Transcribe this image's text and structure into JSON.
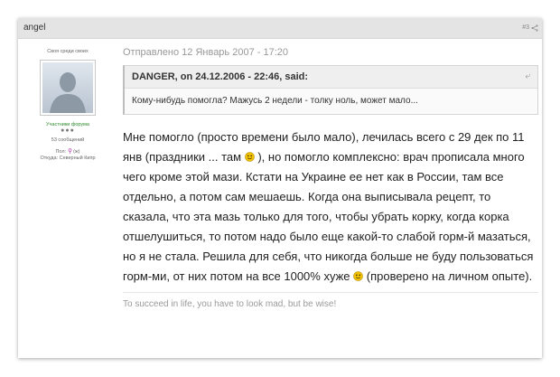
{
  "post": {
    "author": "angel",
    "number": "#3",
    "sidebar": {
      "member_title": "Своя среди своих",
      "group": "Участники форума",
      "pips": "●●●",
      "post_count": "53 сообщений",
      "gender_label": "Пол:",
      "gender_value": "(ж)",
      "location": "Откуда: Северный Кипр"
    },
    "posted_date": "Отправлено 12 Январь 2007 - 17:20",
    "quote": {
      "header": "DANGER, on 24.12.2006 - 22:46, said:",
      "text": "Кому-нибудь помогла? Мажусь 2 недели - толку ноль, может мало..."
    },
    "body": {
      "part1": "Мне помогло (просто времени было мало), лечилась всего с 29 дек по 11 янв (праздники ... там ",
      "part2": " ), но помогло комплексно: врач прописала много чего кроме этой мази. Кстати на Украине ее нет как в России, там все отдельно, а потом сам мешаешь. Когда она выписывала рецепт, то сказала, что эта мазь только для того, чтобы убрать корку, когда корка отшелушиться, то потом надо было еще какой-то слабой горм-й мазаться, но я не стала. Решила для себя, что никогда больше не буду пользоваться горм-ми, от них потом на все 1000% хуже ",
      "part3": " (проверено на личном опыте)."
    },
    "signature": "To succeed in life, you have to look mad, but be wise!"
  },
  "colors": {
    "header_bg": "#e4e4e4",
    "group_green": "#2e8b2e",
    "smiley_yellow": "#f2c200"
  }
}
